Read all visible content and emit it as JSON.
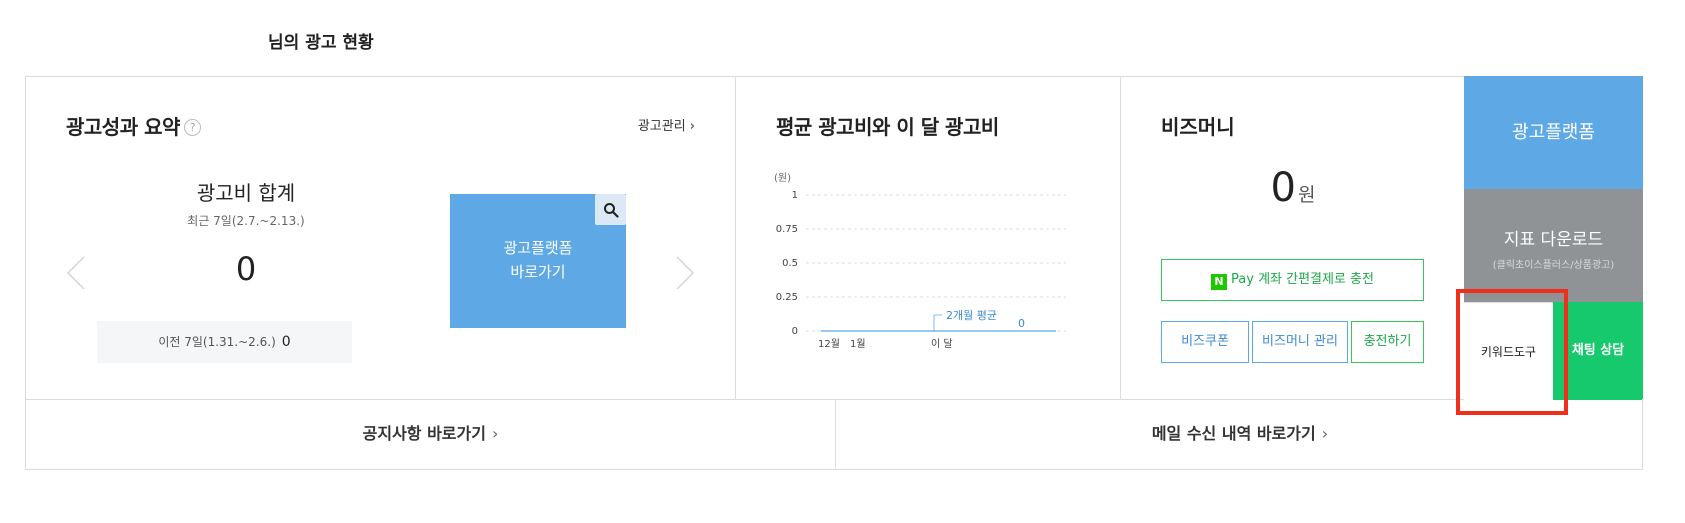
{
  "page_title": "님의 광고 현황",
  "summary": {
    "title": "광고성과 요약",
    "help_icon": "?",
    "manage_link": "광고관리",
    "cost_title": "광고비 합계",
    "period": "최근 7일(2.7.~2.13.)",
    "value": "0",
    "prev_label": "이전 7일(1.31.~2.6.)",
    "prev_value": "0",
    "platform_card_line1": "광고플랫폼",
    "platform_card_line2": "바로가기",
    "search_icon": "search-icon"
  },
  "avg_chart": {
    "title": "평균 광고비와 이 달 광고비"
  },
  "chart_data": {
    "type": "line",
    "ylabel": "(원)",
    "y_ticks": [
      "1",
      "0.75",
      "0.5",
      "0.25",
      "0"
    ],
    "ylim": [
      0,
      1
    ],
    "x_labels": [
      "12월",
      "1월",
      "이 달"
    ],
    "series": [
      {
        "name": "2개월 평균",
        "values": [
          0,
          0,
          0
        ]
      }
    ],
    "annotation_label": "2개월 평균",
    "this_month_value": "0",
    "grid": true
  },
  "bizmoney": {
    "title": "비즈머니",
    "amount": "0",
    "unit": "원",
    "npay_logo": "N",
    "npay_label": "Pay 계좌 간편결제로 충전",
    "coupon_label": "비즈쿠폰",
    "manage_label": "비즈머니 관리",
    "charge_label": "충전하기"
  },
  "side": {
    "platform": "광고플랫폼",
    "download": "지표 다운로드",
    "download_sub": "(클릭초이스플러스/상품광고)",
    "keyword": "키워드도구",
    "chat": "채팅 상담"
  },
  "bottom": {
    "notice": "공지사항 바로가기",
    "mail": "메일 수신 내역 바로가기",
    "chevron": "›"
  },
  "colors": {
    "blue": "#5ea8e5",
    "gray": "#8f9396",
    "green": "#16c96c",
    "highlight": "#f02e1c"
  }
}
